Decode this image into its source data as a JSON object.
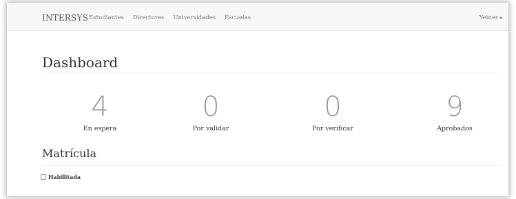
{
  "navbar": {
    "brand": "INTERSYS",
    "links": [
      "Estudiantes",
      "Directores",
      "Universidades",
      "Escuelas"
    ],
    "user": "Yeiner"
  },
  "dashboard": {
    "title": "Dashboard",
    "stats": [
      {
        "value": "4",
        "label": "En espera"
      },
      {
        "value": "0",
        "label": "Por validar"
      },
      {
        "value": "0",
        "label": "Por verificar"
      },
      {
        "value": "9",
        "label": "Aprobados"
      }
    ]
  },
  "matricula": {
    "title": "Matrícula",
    "checkbox_label": "Habilitada",
    "checked": false
  }
}
